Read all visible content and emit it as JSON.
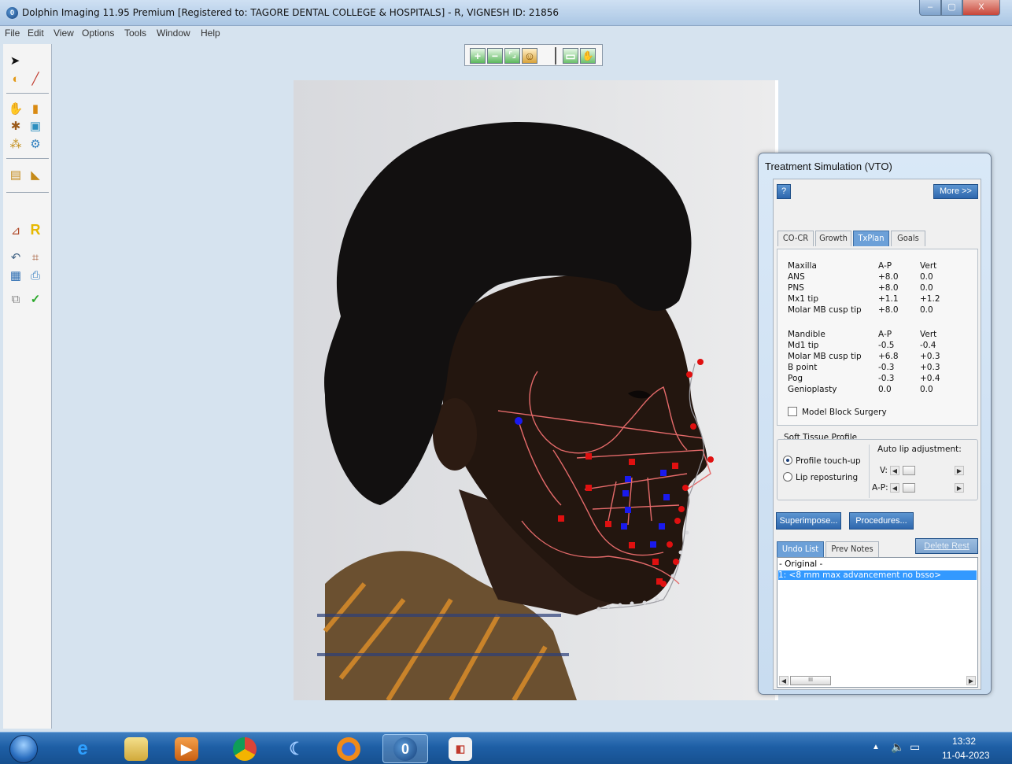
{
  "window": {
    "title": "Dolphin Imaging 11.95 Premium [Registered to: TAGORE DENTAL COLLEGE & HOSPITALS] - R, VIGNESH  ID: 21856",
    "app_icon": "dolphin-icon",
    "controls": {
      "minimize": "–",
      "maximize": "▢",
      "close": "X"
    }
  },
  "menu": [
    "File",
    "Edit",
    "View",
    "Options",
    "Tools",
    "Window",
    "Help"
  ],
  "zoom_toolbar": {
    "buttons": [
      "zoom-in-icon",
      "zoom-out-icon",
      "fit-to-window-icon",
      "face-view-icon",
      "screen-icon",
      "hand-pan-icon"
    ]
  },
  "left_toolbar": {
    "tools": [
      "pointer-icon",
      "digitize-icon",
      "brush-icon",
      "lasso-icon",
      "crop-icon",
      "trace-icon",
      "superimpose-icon",
      "wand-icon",
      "settings-icon",
      "folder-icon",
      "ruler-icon",
      "measure-icon",
      "r-report-icon",
      "undo-icon",
      "grid-icon",
      "save-icon",
      "print-icon",
      "copy-icon",
      "check-icon"
    ],
    "report_glyph": "R"
  },
  "vto": {
    "title": "Treatment Simulation (VTO)",
    "help_label": "?",
    "more_label": "More >>",
    "tabs": [
      "CO-CR",
      "Growth",
      "TxPlan",
      "Goals"
    ],
    "active_tab": "TxPlan",
    "maxilla": {
      "header": [
        "Maxilla",
        "A-P",
        "Vert"
      ],
      "rows": [
        [
          "ANS",
          "+8.0",
          "0.0"
        ],
        [
          "PNS",
          "+8.0",
          "0.0"
        ],
        [
          "Mx1 tip",
          "+1.1",
          "+1.2"
        ],
        [
          "Molar MB cusp tip",
          "+8.0",
          "0.0"
        ]
      ]
    },
    "mandible": {
      "header": [
        "Mandible",
        "A-P",
        "Vert"
      ],
      "rows": [
        [
          "Md1 tip",
          "-0.5",
          "-0.4"
        ],
        [
          "Molar MB cusp tip",
          "+6.8",
          "+0.3"
        ],
        [
          "B point",
          "-0.3",
          "+0.3"
        ],
        [
          "Pog",
          "-0.3",
          "+0.4"
        ],
        [
          "Genioplasty",
          "0.0",
          "0.0"
        ]
      ]
    },
    "model_block_label": "Model Block Surgery",
    "model_block_checked": false,
    "soft_tissue": {
      "group_label": "Soft Tissue Profile",
      "option_touchup": "Profile touch-up",
      "option_reposition": "Lip reposturing",
      "selected": "Profile touch-up",
      "auto_lip_label": "Auto lip adjustment:",
      "v_label": "V:",
      "ap_label": "A-P:"
    },
    "superimpose_label": "Superimpose...",
    "procedures_label": "Procedures...",
    "undo_tab": "Undo List",
    "notes_tab": "Prev Notes",
    "delete_rest_label": "Delete Rest",
    "undo_items": [
      "- Original -",
      "1:  <8 mm max advancement no bsso>"
    ],
    "hscroll_thumb": "III"
  },
  "taskbar": {
    "icons": [
      "start-orb-icon",
      "internet-explorer-icon",
      "file-explorer-icon",
      "media-player-icon",
      "chrome-icon",
      "dolphin-app-icon",
      "firefox-icon",
      "dolphin-imaging-icon",
      "pdf-icon"
    ],
    "tray": {
      "time": "13:32",
      "date": "11-04-2023"
    }
  },
  "colors": {
    "title_bar": "#b9d1ea",
    "workspace": "#d6e3ef",
    "accent": "#3399ff",
    "landmark_red": "#e01010",
    "landmark_blue": "#1a1aee"
  }
}
